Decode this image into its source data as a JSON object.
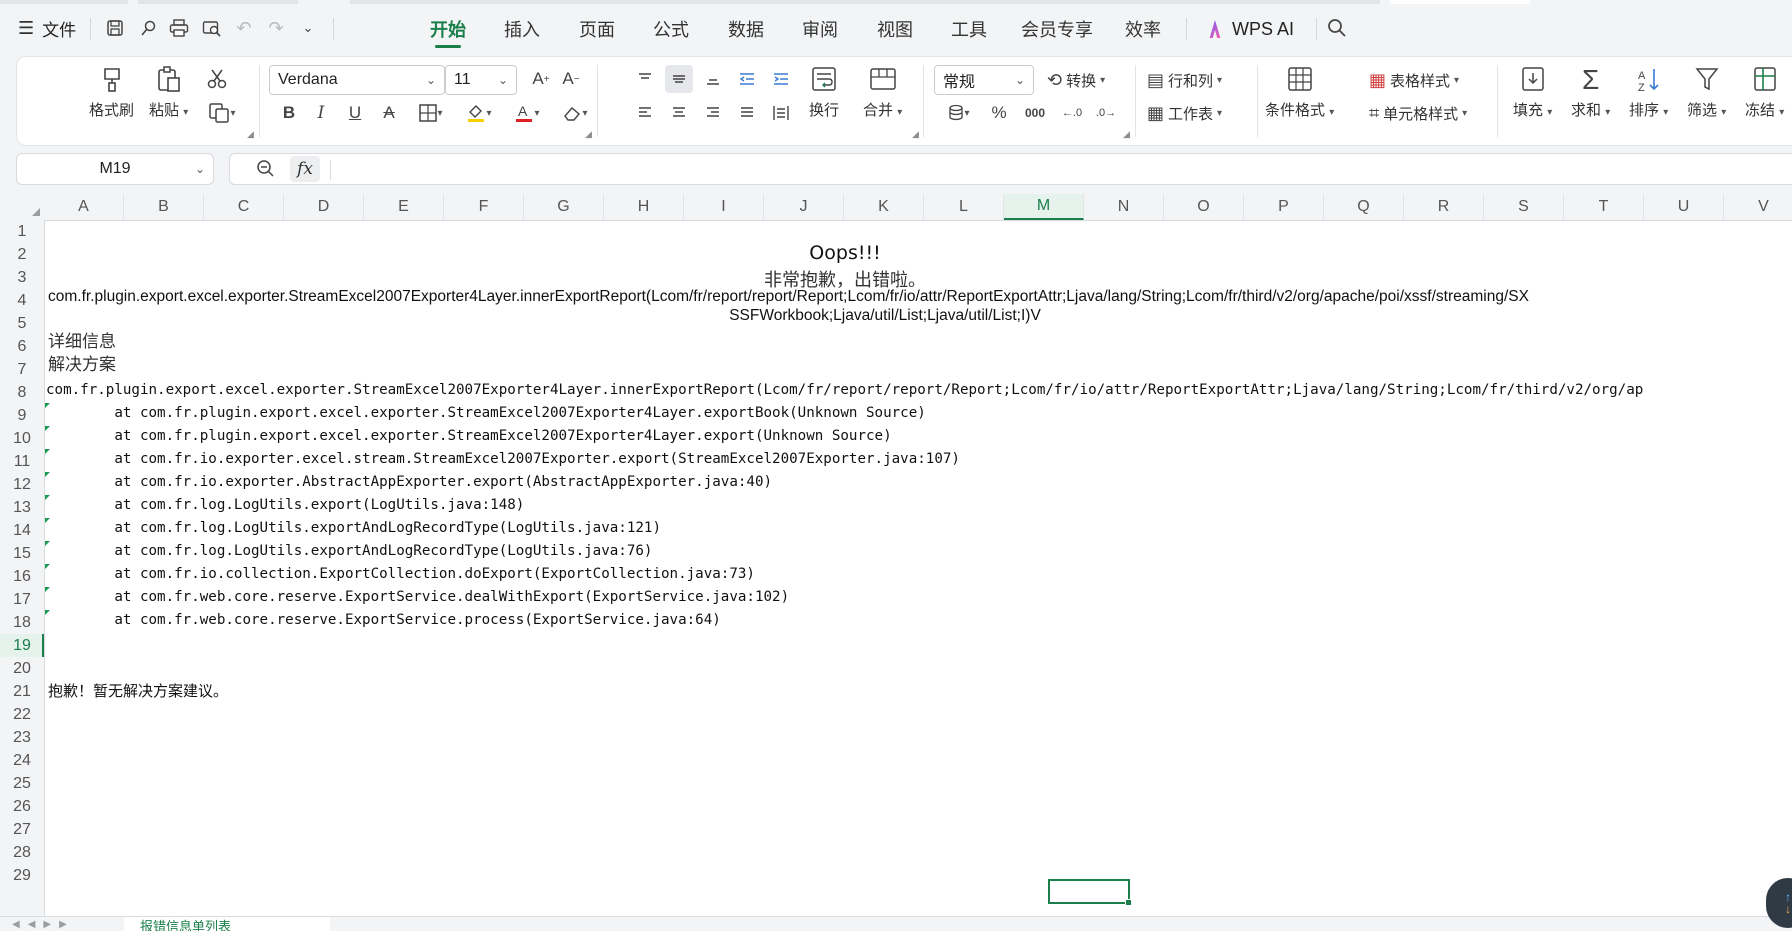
{
  "menubar": {
    "file_label": "文件",
    "menu_icon": "hamburger-icon",
    "quick_access": [
      "save-icon",
      "format-painter-icon",
      "print-icon",
      "print-preview-icon",
      "undo-icon",
      "redo-icon",
      "more-chevron-icon"
    ],
    "tabs": [
      "开始",
      "插入",
      "页面",
      "公式",
      "数据",
      "审阅",
      "视图",
      "工具",
      "会员专享",
      "效率"
    ],
    "active_tab": "开始",
    "ai_label": "WPS AI",
    "search_icon": "search-icon",
    "accent_color": "#1a7f4b"
  },
  "ribbon": {
    "format_painter": "格式刷",
    "paste": "粘贴",
    "font_name": "Verdana",
    "font_size": "11",
    "wrap": "换行",
    "merge": "合并",
    "number_format": "常规",
    "convert": "转换",
    "rows_cols": "行和列",
    "worksheet": "工作表",
    "conditional_format": "条件格式",
    "table_style": "表格样式",
    "cell_style": "单元格样式",
    "fill": "填充",
    "sum": "求和",
    "sort": "排序",
    "filter": "筛选",
    "freeze": "冻结",
    "percent": "%",
    "thousands": "000"
  },
  "formula_bar": {
    "name_box": "M19",
    "fx_label": "fx",
    "value": ""
  },
  "columns": [
    "A",
    "B",
    "C",
    "D",
    "E",
    "F",
    "G",
    "H",
    "I",
    "J",
    "K",
    "L",
    "M",
    "N",
    "O",
    "P",
    "Q",
    "R",
    "S",
    "T",
    "U",
    "V"
  ],
  "selected_column": "M",
  "rows": [
    "1",
    "2",
    "3",
    "4",
    "5",
    "6",
    "7",
    "8",
    "9",
    "10",
    "11",
    "12",
    "13",
    "14",
    "15",
    "16",
    "17",
    "18",
    "19",
    "20",
    "21",
    "22",
    "23",
    "24",
    "25",
    "26",
    "27",
    "28",
    "29"
  ],
  "selected_row": "19",
  "cells": {
    "title": "Oops!!!",
    "subtitle": "非常抱歉，出错啦。",
    "error_line1": "com.fr.plugin.export.excel.exporter.StreamExcel2007Exporter4Layer.innerExportReport(Lcom/fr/report/report/Report;Lcom/fr/io/attr/ReportExportAttr;Ljava/lang/String;Lcom/fr/third/v2/org/apache/poi/xssf/streaming/SX",
    "error_line2": "SSFWorkbook;Ljava/util/List;Ljava/util/List;I)V",
    "details_label": "详细信息",
    "solution_label": "解决方案",
    "trace": [
      "com.fr.plugin.export.excel.exporter.StreamExcel2007Exporter4Layer.innerExportReport(Lcom/fr/report/report/Report;Lcom/fr/io/attr/ReportExportAttr;Ljava/lang/String;Lcom/fr/third/v2/org/ap",
      "        at com.fr.plugin.export.excel.exporter.StreamExcel2007Exporter4Layer.exportBook(Unknown Source)",
      "        at com.fr.plugin.export.excel.exporter.StreamExcel2007Exporter4Layer.export(Unknown Source)",
      "        at com.fr.io.exporter.excel.stream.StreamExcel2007Exporter.export(StreamExcel2007Exporter.java:107)",
      "        at com.fr.io.exporter.AbstractAppExporter.export(AbstractAppExporter.java:40)",
      "        at com.fr.log.LogUtils.export(LogUtils.java:148)",
      "        at com.fr.log.LogUtils.exportAndLogRecordType(LogUtils.java:121)",
      "        at com.fr.log.LogUtils.exportAndLogRecordType(LogUtils.java:76)",
      "        at com.fr.io.collection.ExportCollection.doExport(ExportCollection.java:73)",
      "        at com.fr.web.core.reserve.ExportService.dealWithExport(ExportService.java:102)",
      "        at com.fr.web.core.reserve.ExportService.process(ExportService.java:64)"
    ],
    "no_solution": "抱歉！暂无解决方案建议。"
  },
  "sheet_tab": "报错信息单列表"
}
